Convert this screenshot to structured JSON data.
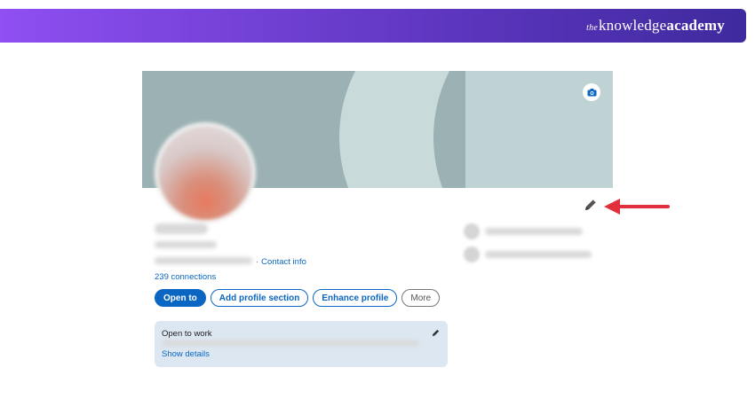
{
  "brand": {
    "prefix": "the",
    "word1": "knowledge",
    "word2": "academy"
  },
  "profile": {
    "contact_info": "Contact info",
    "connections": "239 connections",
    "actions": {
      "open_to": "Open to",
      "add_section": "Add profile section",
      "enhance": "Enhance profile",
      "more": "More"
    },
    "open_to_work": {
      "title": "Open to work",
      "link": "Show details"
    }
  },
  "colors": {
    "linkedin_blue": "#0a66c2",
    "arrow_red": "#e0303c",
    "brand_start": "#8f4ff2",
    "brand_end": "#3f2a9e"
  },
  "icons": [
    "camera-icon",
    "pencil-icon",
    "red-arrow-icon"
  ]
}
